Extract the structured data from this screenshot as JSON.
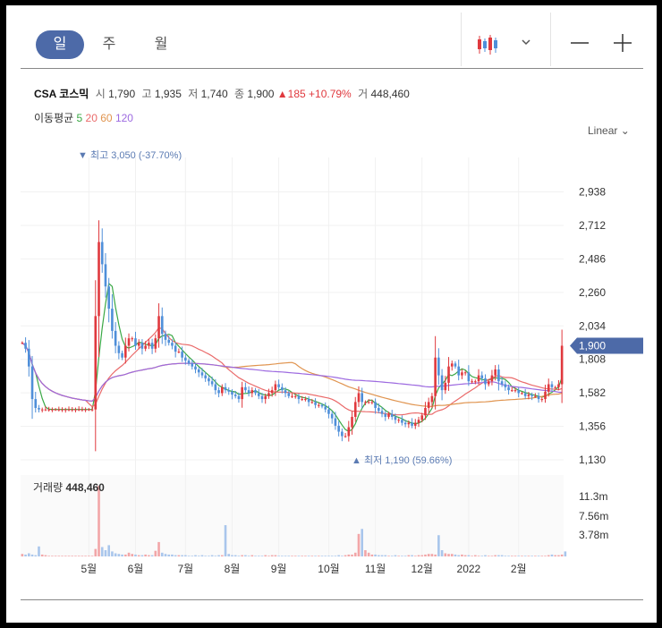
{
  "periods": {
    "day": "일",
    "week": "주",
    "month": "월"
  },
  "toolbar": {
    "zoom_out": "—",
    "zoom_in": "+",
    "chart_type_icon": "candlestick-icon",
    "dropdown_icon": "chevron-down-icon"
  },
  "quote": {
    "name": "CSA 코스믹",
    "open_label": "시",
    "open": "1,790",
    "high_label": "고",
    "high": "1,935",
    "low_label": "저",
    "low": "1,740",
    "close_label": "종",
    "close": "1,900",
    "change": "▲185",
    "change_pct": "+10.79%",
    "volume_label": "거",
    "volume": "448,460"
  },
  "ma_legend": {
    "label": "이동평균",
    "periods": [
      {
        "value": "5",
        "color": "#3aa845"
      },
      {
        "value": "20",
        "color": "#ea6a6a"
      },
      {
        "value": "60",
        "color": "#e0944f"
      },
      {
        "value": "120",
        "color": "#9d6ae0"
      }
    ]
  },
  "scale_mode": "Linear ⌄",
  "colors": {
    "up": "#e0393e",
    "down": "#4f8fd9",
    "badge": "#4d6aa8",
    "grid": "#f1f1f1"
  },
  "chart_data": {
    "type": "candlestick",
    "price_axis": {
      "ticks": [
        "2,938",
        "2,712",
        "2,486",
        "2,260",
        "2,034",
        "1,808",
        "1,582",
        "1,356",
        "1,130"
      ],
      "min": 1130,
      "max": 3050
    },
    "current_price_label": "1,900",
    "high_annotation": "▼ 최고 3,050 (-37.70%)",
    "low_annotation": "▲ 최저 1,190 (59.66%)",
    "x_ticks": [
      "5월",
      "6월",
      "7월",
      "8월",
      "9월",
      "10월",
      "11월",
      "12월",
      "2022",
      "2월"
    ],
    "volume_title": "거래량",
    "volume_value": "448,460",
    "volume_axis": {
      "ticks": [
        "11.3m",
        "7.56m",
        "3.78m"
      ]
    },
    "close_series": [
      1920,
      1880,
      1760,
      1540,
      1480,
      1470,
      1470,
      1470,
      1470,
      1470,
      1470,
      1470,
      1470,
      1470,
      1470,
      1470,
      1470,
      1470,
      1470,
      1470,
      1470,
      1470,
      2100,
      2600,
      2450,
      2300,
      2150,
      2000,
      1900,
      1850,
      1820,
      1900,
      1950,
      1950,
      1900,
      1920,
      1880,
      1900,
      1920,
      1880,
      1950,
      2100,
      1980,
      1940,
      1920,
      1900,
      1860,
      1860,
      1820,
      1800,
      1780,
      1760,
      1740,
      1720,
      1700,
      1680,
      1660,
      1640,
      1600,
      1580,
      1620,
      1600,
      1590,
      1570,
      1560,
      1540,
      1620,
      1600,
      1580,
      1600,
      1580,
      1560,
      1540,
      1560,
      1580,
      1600,
      1640,
      1620,
      1600,
      1580,
      1560,
      1560,
      1560,
      1540,
      1540,
      1540,
      1520,
      1520,
      1500,
      1500,
      1490,
      1470,
      1440,
      1410,
      1360,
      1320,
      1290,
      1290,
      1350,
      1420,
      1520,
      1580,
      1520,
      1520,
      1520,
      1520,
      1480,
      1460,
      1440,
      1420,
      1440,
      1420,
      1400,
      1400,
      1380,
      1370,
      1380,
      1360,
      1380,
      1400,
      1430,
      1480,
      1520,
      1560,
      1820,
      1700,
      1600,
      1650,
      1760,
      1780,
      1760,
      1700,
      1720,
      1720,
      1660,
      1660,
      1660,
      1700,
      1680,
      1640,
      1660,
      1700,
      1740,
      1660,
      1640,
      1620,
      1600,
      1600,
      1600,
      1580,
      1580,
      1560,
      1570,
      1560,
      1560,
      1540,
      1540,
      1590,
      1640,
      1620,
      1620,
      1640,
      1900
    ],
    "volume_series": [
      0.4,
      0.3,
      0.5,
      0.3,
      0.2,
      1.6,
      0.3,
      0.2,
      0.1,
      0.1,
      0.1,
      0.1,
      0.1,
      0.1,
      0.1,
      0.1,
      0.1,
      0.1,
      0.1,
      0.1,
      0.1,
      0.1,
      1.2,
      11.3,
      1.5,
      1.0,
      1.8,
      0.8,
      0.5,
      0.4,
      0.3,
      0.3,
      0.6,
      0.4,
      0.3,
      0.2,
      0.2,
      0.3,
      0.2,
      0.2,
      0.9,
      2.3,
      0.6,
      0.4,
      0.3,
      0.3,
      0.2,
      0.2,
      0.2,
      0.2,
      0.1,
      0.1,
      0.2,
      0.1,
      0.2,
      0.1,
      0.1,
      0.2,
      0.1,
      0.2,
      0.2,
      5.0,
      0.4,
      0.2,
      0.2,
      0.1,
      0.2,
      0.2,
      0.1,
      0.2,
      0.1,
      0.1,
      0.1,
      0.2,
      0.1,
      0.2,
      0.2,
      0.1,
      0.1,
      0.1,
      0.1,
      0.1,
      0.1,
      0.1,
      0.1,
      0.1,
      0.1,
      0.1,
      0.1,
      0.1,
      0.1,
      0.1,
      0.1,
      0.1,
      0.1,
      0.2,
      0.1,
      0.2,
      0.3,
      0.3,
      0.6,
      3.6,
      4.4,
      1.0,
      0.6,
      0.3,
      0.3,
      0.2,
      0.2,
      0.2,
      0.1,
      0.1,
      0.2,
      0.1,
      0.1,
      0.1,
      0.2,
      0.2,
      0.1,
      0.2,
      0.2,
      0.3,
      0.4,
      0.4,
      0.3,
      3.4,
      1.0,
      0.5,
      0.4,
      0.4,
      0.3,
      0.2,
      0.3,
      0.2,
      0.2,
      0.1,
      0.2,
      0.1,
      0.1,
      0.2,
      0.1,
      0.1,
      0.2,
      0.2,
      0.2,
      0.1,
      0.1,
      0.1,
      0.1,
      0.1,
      0.1,
      0.1,
      0.1,
      0.1,
      0.1,
      0.1,
      0.1,
      0.1,
      0.2,
      0.3,
      0.2,
      0.2,
      0.3,
      0.8
    ]
  }
}
